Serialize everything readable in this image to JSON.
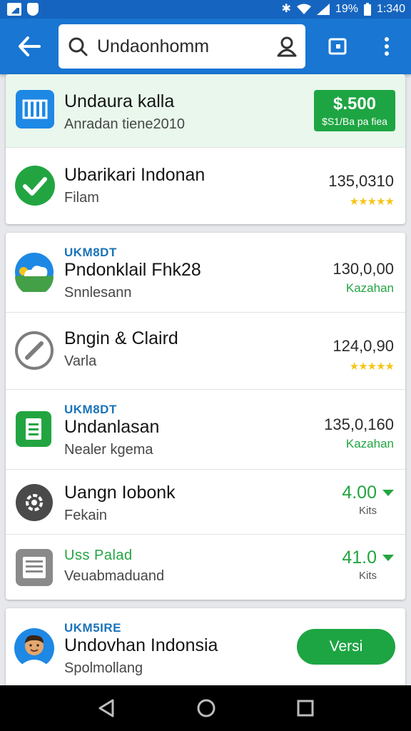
{
  "status_bar": {
    "battery": "19%",
    "time": "1:340"
  },
  "search": {
    "query": "Undaonhomm"
  },
  "featured": {
    "title": "Undaura kalla",
    "subtitle": "Anradan tiene2010",
    "price": "$.500",
    "price_note": "$S1/Ba pa fiea"
  },
  "top_item": {
    "title": "Ubarikari Indonan",
    "subtitle": "Filam",
    "value": "135,0310",
    "stars": "★★★★★"
  },
  "list": [
    {
      "eyebrow": "UKM8DT",
      "title": "Pndonklail Fhk28",
      "subtitle": "Snnlesann",
      "value": "130,0,00",
      "tag": "Kazahan",
      "icon": "weather-icon"
    },
    {
      "eyebrow": "",
      "title": "Bngin & Claird",
      "subtitle": "Varla",
      "value": "124,0,90",
      "stars": "★★★★★",
      "icon": "edit-icon"
    },
    {
      "eyebrow": "UKM8DT",
      "title": "Undanlasan",
      "subtitle": "Nealer kgema",
      "value": "135,0,160",
      "tag": "Kazahan",
      "icon": "sheets-icon"
    },
    {
      "eyebrow": "",
      "title": "Uangn Iobonk",
      "subtitle": "Fekain",
      "value": "4.00",
      "unit": "Kits",
      "icon": "settings-icon"
    },
    {
      "eyebrow": "Uss Palad",
      "title": "",
      "subtitle": "Veuabmaduand",
      "value": "41.0",
      "unit": "Kits",
      "icon": "document-icon"
    }
  ],
  "profile": {
    "eyebrow": "UKM5IRE",
    "title": "Undovhan Indonsia",
    "subtitle": "Spolmollang",
    "button": "Versi"
  },
  "colors": {
    "primary": "#1976d2",
    "accent": "#1ea543",
    "star": "#f5c518"
  }
}
